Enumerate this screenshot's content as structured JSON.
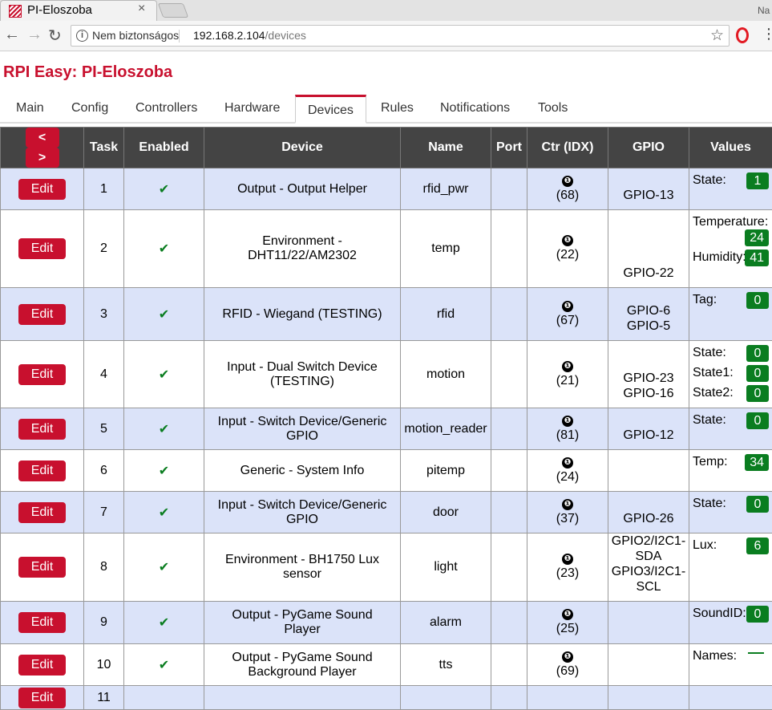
{
  "browser": {
    "tab_title": "PI-Eloszoba",
    "tab_close": "×",
    "corner_text": "Na",
    "security_text": "Nem biztonságos",
    "url_host": "192.168.2.104",
    "url_path": "/devices",
    "accent_color": "#c8102e"
  },
  "page": {
    "title": "RPI Easy: PI-Eloszoba",
    "menu": [
      "Main",
      "Config",
      "Controllers",
      "Hardware",
      "Devices",
      "Rules",
      "Notifications",
      "Tools"
    ],
    "active_menu": "Devices",
    "prev_label": "<",
    "next_label": ">",
    "edit_label": "Edit",
    "check_mark": "✔",
    "ctr_icon": "❶",
    "colors": {
      "row_odd": "#dbe3f9",
      "header_bg": "#444444",
      "value_badge": "#0a7d20",
      "button": "#c8102e"
    }
  },
  "table": {
    "headers": [
      "Task",
      "Enabled",
      "Device",
      "Name",
      "Port",
      "Ctr (IDX)",
      "GPIO",
      "Values"
    ],
    "rows": [
      {
        "task": "1",
        "device": "Output - Output Helper",
        "name": "rfid_pwr",
        "port": "",
        "idx": "(68)",
        "gpio": [
          "GPIO-13"
        ],
        "values": [
          {
            "name": "State:",
            "value": "1"
          }
        ]
      },
      {
        "task": "2",
        "device": "Environment - DHT11/22/AM2302",
        "name": "temp",
        "port": "",
        "idx": "(22)",
        "gpio": [
          "GPIO-22"
        ],
        "values": [
          {
            "name": "Temperature:",
            "value": "24"
          },
          {
            "name": "Humidity:",
            "value": "41"
          }
        ]
      },
      {
        "task": "3",
        "device": "RFID - Wiegand (TESTING)",
        "name": "rfid",
        "port": "",
        "idx": "(67)",
        "gpio": [
          "GPIO-6",
          "GPIO-5"
        ],
        "values": [
          {
            "name": "Tag:",
            "value": "0"
          }
        ]
      },
      {
        "task": "4",
        "device": "Input - Dual Switch Device (TESTING)",
        "name": "motion",
        "port": "",
        "idx": "(21)",
        "gpio": [
          "GPIO-23",
          "GPIO-16"
        ],
        "values": [
          {
            "name": "State:",
            "value": "0"
          },
          {
            "name": "State1:",
            "value": "0"
          },
          {
            "name": "State2:",
            "value": "0"
          }
        ]
      },
      {
        "task": "5",
        "device": "Input - Switch Device/Generic GPIO",
        "name": "motion_reader",
        "port": "",
        "idx": "(81)",
        "gpio": [
          "GPIO-12"
        ],
        "values": [
          {
            "name": "State:",
            "value": "0"
          }
        ]
      },
      {
        "task": "6",
        "device": "Generic - System Info",
        "name": "pitemp",
        "port": "",
        "idx": "(24)",
        "gpio": [],
        "values": [
          {
            "name": "Temp:",
            "value": "34"
          }
        ]
      },
      {
        "task": "7",
        "device": "Input - Switch Device/Generic GPIO",
        "name": "door",
        "port": "",
        "idx": "(37)",
        "gpio": [
          "GPIO-26"
        ],
        "values": [
          {
            "name": "State:",
            "value": "0"
          }
        ]
      },
      {
        "task": "8",
        "device": "Environment - BH1750 Lux sensor",
        "name": "light",
        "port": "",
        "idx": "(23)",
        "gpio": [
          "GPIO2/I2C1-SDA",
          "GPIO3/I2C1-SCL"
        ],
        "values": [
          {
            "name": "Lux:",
            "value": "6"
          }
        ]
      },
      {
        "task": "9",
        "device": "Output - PyGame Sound Player",
        "name": "alarm",
        "port": "",
        "idx": "(25)",
        "gpio": [],
        "values": [
          {
            "name": "SoundID:",
            "value": "0"
          }
        ]
      },
      {
        "task": "10",
        "device": "Output - PyGame Sound Background Player",
        "name": "tts",
        "port": "",
        "idx": "(69)",
        "gpio": [],
        "values": [
          {
            "name": "Names:",
            "value": ""
          }
        ]
      },
      {
        "task": "11",
        "device": "",
        "name": "",
        "port": "",
        "idx": "",
        "gpio": [],
        "values": []
      }
    ]
  }
}
